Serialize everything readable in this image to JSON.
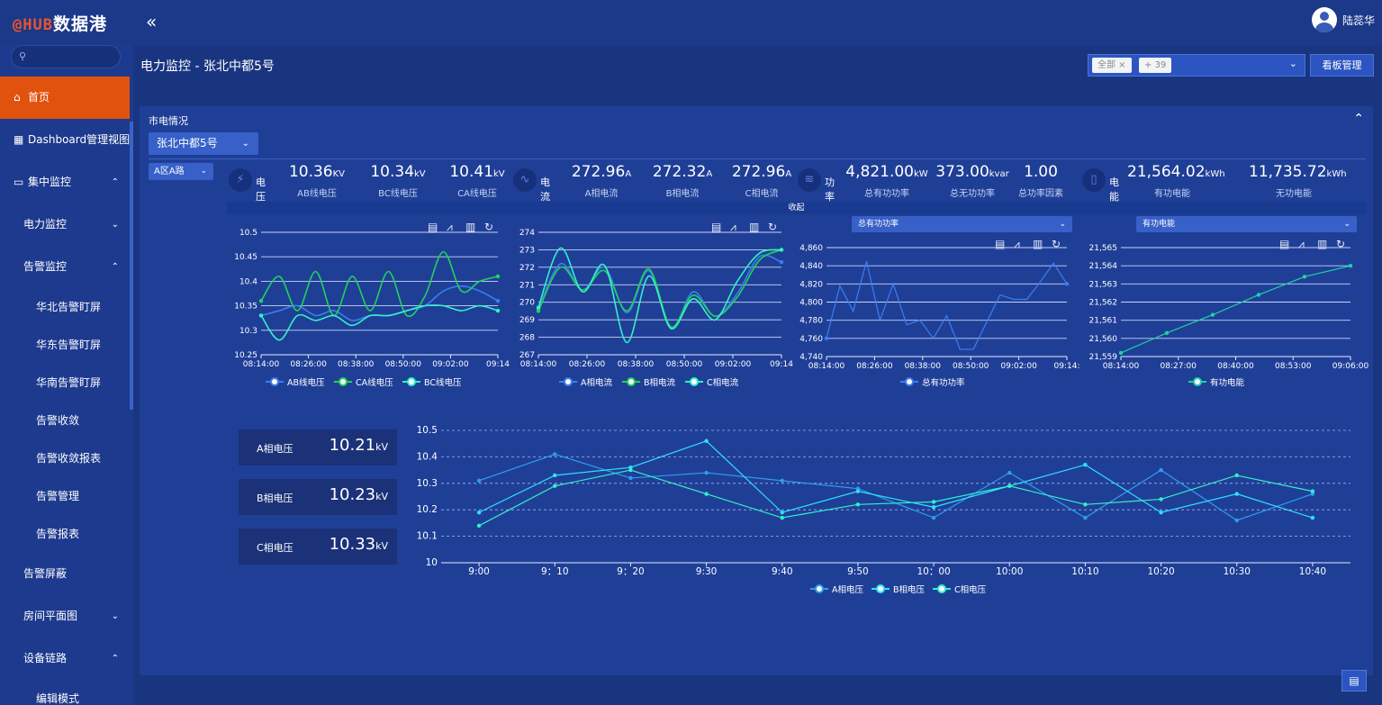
{
  "app": {
    "logo_a": "@HUB",
    "logo_b": "数据港",
    "collapse_icon": "«",
    "user_name": "陆蕊华"
  },
  "sidebar": {
    "search_placeholder": "",
    "items": [
      {
        "label": "首页",
        "icon": "⌂",
        "level": 1,
        "active": true,
        "arrow": ""
      },
      {
        "label": "Dashboard管理视图",
        "icon": "▦",
        "level": 1,
        "active": false,
        "arrow": "⌄"
      },
      {
        "label": "集中监控",
        "icon": "▭",
        "level": 1,
        "active": false,
        "arrow": "⌃"
      },
      {
        "label": "电力监控",
        "icon": "",
        "level": 2,
        "active": false,
        "arrow": "⌄"
      },
      {
        "label": "告警监控",
        "icon": "",
        "level": 2,
        "active": false,
        "arrow": "⌃"
      },
      {
        "label": "华北告警盯屏",
        "icon": "",
        "level": 3,
        "active": false,
        "arrow": ""
      },
      {
        "label": "华东告警盯屏",
        "icon": "",
        "level": 3,
        "active": false,
        "arrow": ""
      },
      {
        "label": "华南告警盯屏",
        "icon": "",
        "level": 3,
        "active": false,
        "arrow": ""
      },
      {
        "label": "告警收敛",
        "icon": "",
        "level": 3,
        "active": false,
        "arrow": ""
      },
      {
        "label": "告警收敛报表",
        "icon": "",
        "level": 3,
        "active": false,
        "arrow": ""
      },
      {
        "label": "告警管理",
        "icon": "",
        "level": 3,
        "active": false,
        "arrow": ""
      },
      {
        "label": "告警报表",
        "icon": "",
        "level": 3,
        "active": false,
        "arrow": ""
      },
      {
        "label": "告警屏蔽",
        "icon": "",
        "level": 2,
        "active": false,
        "arrow": ""
      },
      {
        "label": "房间平面图",
        "icon": "",
        "level": 2,
        "active": false,
        "arrow": "⌄"
      },
      {
        "label": "设备链路",
        "icon": "",
        "level": 2,
        "active": false,
        "arrow": "⌃"
      },
      {
        "label": "编辑模式",
        "icon": "",
        "level": 3,
        "active": false,
        "arrow": ""
      }
    ]
  },
  "header": {
    "page_title": "电力监控 - 张北中都5号",
    "tag_all": "全部 ×",
    "tag_more": "+ 39",
    "board_button": "看板管理"
  },
  "panel": {
    "title": "市电情况",
    "site": "张北中都5号",
    "sub_circuit": "A区A路",
    "fold_label": "收起",
    "groups": [
      {
        "name": "电压",
        "icon": "⚡",
        "metrics": [
          {
            "value": "10.36",
            "unit": "KV",
            "label": "AB线电压"
          },
          {
            "value": "10.34",
            "unit": "kV",
            "label": "BC线电压"
          },
          {
            "value": "10.41",
            "unit": "kV",
            "label": "CA线电压"
          }
        ]
      },
      {
        "name": "电流",
        "icon": "∿",
        "metrics": [
          {
            "value": "272.96",
            "unit": "A",
            "label": "A相电流"
          },
          {
            "value": "272.32",
            "unit": "A",
            "label": "B相电流"
          },
          {
            "value": "272.96",
            "unit": "A",
            "label": "C相电流"
          }
        ]
      },
      {
        "name": "功率",
        "icon": "≋",
        "metrics": [
          {
            "value": "4,821.00",
            "unit": "kW",
            "label": "总有功功率"
          },
          {
            "value": "373.00",
            "unit": "kvar",
            "label": "总无功功率"
          },
          {
            "value": "1.00",
            "unit": "",
            "label": "总功率因素"
          }
        ]
      },
      {
        "name": "电能",
        "icon": "▯",
        "metrics": [
          {
            "value": "21,564.02",
            "unit": "kWh",
            "label": "有功电能"
          },
          {
            "value": "11,735.72",
            "unit": "kWh",
            "label": "无功电能"
          }
        ]
      }
    ],
    "power_select": "总有功功率",
    "energy_select": "有功电能",
    "phase_cards": [
      {
        "label": "A相电压",
        "value": "10.21",
        "unit": "kV"
      },
      {
        "label": "B相电压",
        "value": "10.23",
        "unit": "kV"
      },
      {
        "label": "C相电压",
        "value": "10.33",
        "unit": "kV"
      }
    ]
  },
  "colors": {
    "panel_bg": "#1f3f97",
    "active_menu": "#e2520f",
    "green": "#1ed35a",
    "teal": "#33f0c8",
    "blue": "#3d7df0",
    "cyan": "#2fe0ff"
  },
  "chart_data": [
    {
      "type": "line",
      "x": [
        "08:14:00",
        "08:26:00",
        "08:38:00",
        "08:50:00",
        "09:02:00",
        "09:14"
      ],
      "ylim": [
        10.25,
        10.5
      ],
      "yticks": [
        "10.25",
        "10.3",
        "10.35",
        "10.4",
        "10.45",
        "10.5"
      ],
      "series": [
        {
          "name": "AB线电压",
          "color": "#3d7df0",
          "values": [
            10.33,
            10.34,
            10.35,
            10.33,
            10.34,
            10.32,
            10.33,
            10.33,
            10.34,
            10.35,
            10.38,
            10.39,
            10.38,
            10.36
          ]
        },
        {
          "name": "CA线电压",
          "color": "#1ed35a",
          "values": [
            10.36,
            10.41,
            10.34,
            10.42,
            10.33,
            10.41,
            10.34,
            10.42,
            10.33,
            10.37,
            10.46,
            10.38,
            10.4,
            10.41
          ]
        },
        {
          "name": "BC线电压",
          "color": "#33f0c8",
          "values": [
            10.33,
            10.28,
            10.33,
            10.32,
            10.33,
            10.31,
            10.33,
            10.33,
            10.34,
            10.35,
            10.35,
            10.34,
            10.35,
            10.34
          ]
        }
      ]
    },
    {
      "type": "line",
      "x": [
        "08:14:00",
        "08:26:00",
        "08:38:00",
        "08:50:00",
        "09:02:00",
        "09:14"
      ],
      "ylim": [
        267,
        274
      ],
      "yticks": [
        "267",
        "268",
        "269",
        "270",
        "271",
        "272",
        "273",
        "274"
      ],
      "series": [
        {
          "name": "A相电流",
          "color": "#3d7df0",
          "values": [
            269.6,
            272.2,
            270.7,
            272.0,
            269.4,
            271.8,
            268.5,
            270.6,
            269.2,
            270.5,
            272.6,
            272.3
          ]
        },
        {
          "name": "B相电流",
          "color": "#1ed35a",
          "values": [
            269.5,
            272.0,
            270.7,
            271.8,
            269.5,
            271.9,
            268.6,
            270.4,
            269.2,
            270.3,
            272.4,
            273.0
          ]
        },
        {
          "name": "C相电流",
          "color": "#33f0c8",
          "values": [
            269.7,
            273.1,
            270.6,
            272.1,
            267.7,
            271.5,
            268.5,
            270.2,
            269.0,
            271.2,
            272.8,
            273.0
          ]
        }
      ]
    },
    {
      "type": "line",
      "x": [
        "08:14:00",
        "08:26:00",
        "08:38:00",
        "08:50:00",
        "09:02:00",
        "09:14:"
      ],
      "ylim": [
        4740,
        4860
      ],
      "yticks": [
        "4,740",
        "4,760",
        "4,780",
        "4,800",
        "4,820",
        "4,840",
        "4,860"
      ],
      "series": [
        {
          "name": "总有功功率",
          "color": "#3d7df0",
          "values": [
            4760,
            4818,
            4790,
            4845,
            4780,
            4820,
            4775,
            4780,
            4760,
            4785,
            4748,
            4748,
            4778,
            4808,
            4803,
            4803,
            4822,
            4843,
            4820
          ]
        }
      ]
    },
    {
      "type": "line",
      "x": [
        "08:14:00",
        "08:27:00",
        "08:40:00",
        "08:53:00",
        "09:06:00"
      ],
      "ylim": [
        21559,
        21565
      ],
      "yticks": [
        "21,559",
        "21,560",
        "21,561",
        "21,562",
        "21,563",
        "21,564",
        "21,565"
      ],
      "series": [
        {
          "name": "有功电能",
          "color": "#1fd1a8",
          "values": [
            21559.2,
            21560.3,
            21561.3,
            21562.4,
            21563.4,
            21564.0
          ]
        }
      ]
    },
    {
      "type": "line",
      "x": [
        "9:00",
        "9：10",
        "9：20",
        "9:30",
        "9:40",
        "9:50",
        "10：00",
        "10:00",
        "10:10",
        "10:20",
        "10:30",
        "10:40"
      ],
      "ylim": [
        10,
        10.5
      ],
      "yticks": [
        "10",
        "10.1",
        "10.2",
        "10.3",
        "10.4",
        "10.5"
      ],
      "series": [
        {
          "name": "A相电压",
          "color": "#2f9df0",
          "values": [
            10.31,
            10.41,
            10.32,
            10.34,
            10.31,
            10.28,
            10.17,
            10.34,
            10.17,
            10.35,
            10.16,
            10.26
          ]
        },
        {
          "name": "B相电压",
          "color": "#2fe0ff",
          "values": [
            10.19,
            10.33,
            10.36,
            10.46,
            10.19,
            10.27,
            10.21,
            10.29,
            10.37,
            10.19,
            10.26,
            10.17
          ]
        },
        {
          "name": "C相电压",
          "color": "#33f0c8",
          "values": [
            10.14,
            10.29,
            10.35,
            10.26,
            10.17,
            10.22,
            10.23,
            10.29,
            10.22,
            10.24,
            10.33,
            10.27
          ]
        }
      ]
    }
  ]
}
